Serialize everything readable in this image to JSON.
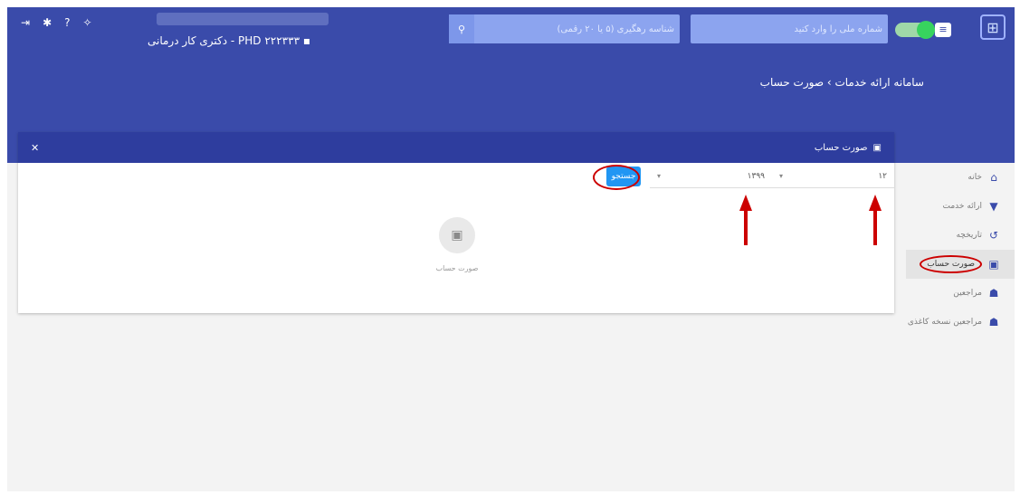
{
  "header": {
    "national_id_placeholder": "شماره ملی را وارد کنید",
    "tracking_placeholder": "شناسه رهگیری (۵ یا ۲۰ رقمی)",
    "user_title": "دکتری کار درمانی - PHD ۲۲۲۳۳۳",
    "breadcrumb": "سامانه ارائه خدمات › صورت حساب",
    "icons": [
      "logout-icon",
      "settings-icon",
      "help-icon",
      "bulb-icon"
    ]
  },
  "sidebar": {
    "items": [
      {
        "label": "خانه",
        "icon": "home-icon"
      },
      {
        "label": "ارائه خدمت",
        "icon": "basket-icon"
      },
      {
        "label": "تاریخچه",
        "icon": "history-icon"
      },
      {
        "label": "صورت حساب",
        "icon": "bill-icon",
        "active": true
      },
      {
        "label": "مراجعین",
        "icon": "people-icon"
      },
      {
        "label": "مراجعین نسخه کاغذی",
        "icon": "people-icon"
      }
    ]
  },
  "panel": {
    "title": "صورت حساب",
    "month_value": "۱۲",
    "year_value": "۱۳۹۹",
    "search_label": "جستجو",
    "empty_text": "صورت حساب"
  },
  "colors": {
    "header_bg": "#3a4baa",
    "panel_head_bg": "#2e3d9e",
    "accent_blue": "#2196f3",
    "annotation_red": "#cc0000"
  }
}
